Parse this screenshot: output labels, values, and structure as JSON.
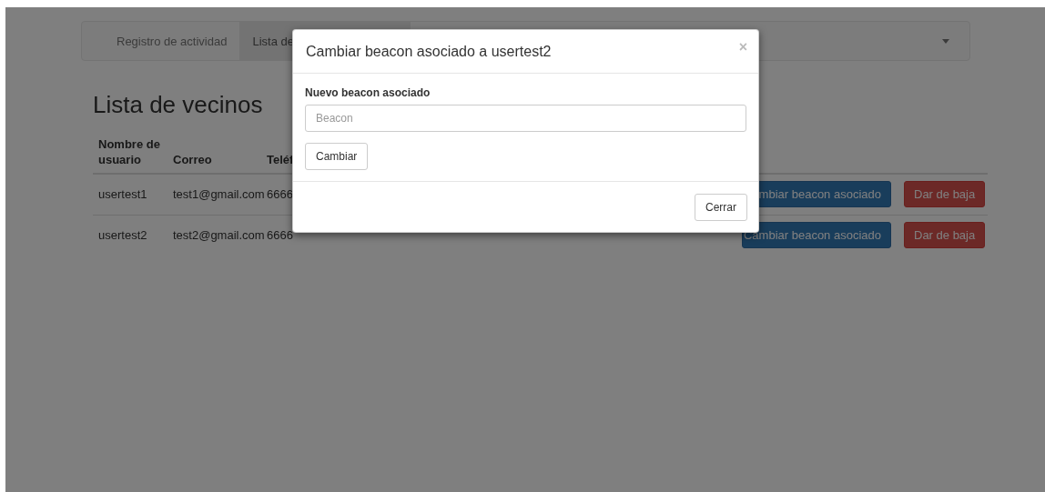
{
  "navbar": {
    "tabs": [
      {
        "label": "Registro de actividad",
        "selected": false
      },
      {
        "label": "Lista de",
        "selected": true
      }
    ]
  },
  "page": {
    "heading": "Lista de vecinos",
    "table": {
      "columns": [
        "Nombre de usuario",
        "Correo",
        "Teléf"
      ],
      "rows": [
        {
          "cells": [
            "usertest1",
            "test1@gmail.com",
            "6666"
          ],
          "actions": [
            {
              "label": "mbiar beacon asociado",
              "kind": "primary"
            },
            {
              "label": "Dar de baja",
              "kind": "danger"
            }
          ]
        },
        {
          "cells": [
            "usertest2",
            "test2@gmail.com",
            "6666"
          ],
          "actions": [
            {
              "label": "Cambiar beacon asociado",
              "kind": "primary"
            },
            {
              "label": "Dar de baja",
              "kind": "danger"
            }
          ]
        }
      ]
    }
  },
  "modal": {
    "title": "Cambiar beacon asociado a usertest2",
    "close_glyph": "×",
    "field": {
      "label": "Nuevo beacon asociado",
      "placeholder": "Beacon"
    },
    "submit": "Cambiar",
    "close": "Cerrar"
  }
}
